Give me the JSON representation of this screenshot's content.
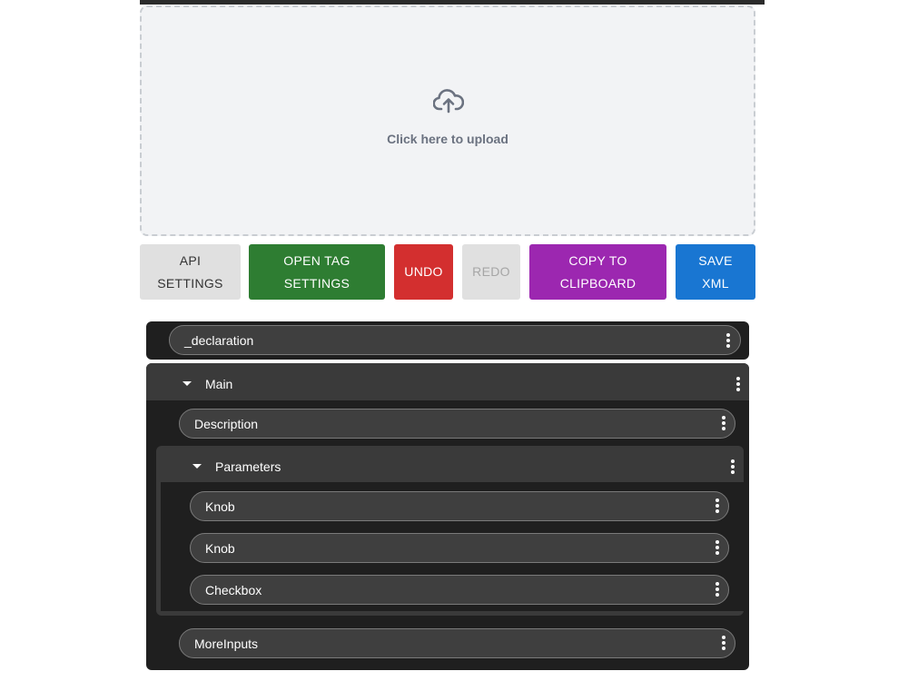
{
  "upload": {
    "text": "Click here to upload",
    "icon": "cloud-upload-icon"
  },
  "toolbar": {
    "api_line1": "API",
    "api_line2": "SETTINGS",
    "open_line1": "OPEN TAG",
    "open_line2": "SETTINGS",
    "undo": "UNDO",
    "redo": "REDO",
    "copy_line1": "COPY TO",
    "copy_line2": "CLIPBOARD",
    "save_line1": "SAVE",
    "save_line2": "XML"
  },
  "tree": {
    "declaration": "_declaration",
    "main": {
      "label": "Main",
      "description": "Description",
      "parameters": {
        "label": "Parameters",
        "items": [
          "Knob",
          "Knob",
          "Checkbox"
        ]
      },
      "more_inputs": "MoreInputs"
    }
  },
  "colors": {
    "open_tag": "#2e7d32",
    "undo": "#d32f2f",
    "copy": "#9c27b0",
    "save": "#1976d2",
    "panel": "#1f1f1f"
  }
}
